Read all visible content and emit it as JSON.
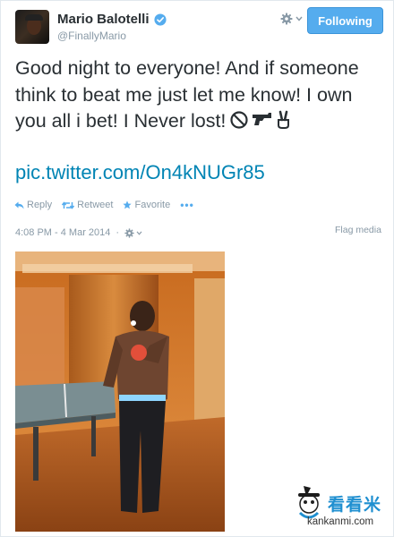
{
  "user": {
    "display_name": "Mario Balotelli",
    "handle": "@FinallyMario",
    "verified": true
  },
  "header": {
    "follow_label": "Following",
    "settings_icon": "gear-icon",
    "accent": "#55acee"
  },
  "tweet": {
    "text": "Good night to everyone! And if someone think to beat me just let me know! I own you all i bet! I Never lost!",
    "emoji_icons": [
      "prohibited-icon",
      "gun-icon",
      "victory-hand-icon"
    ],
    "link": "pic.twitter.com/On4kNUGr85",
    "link_color": "#0084b4"
  },
  "actions": {
    "reply": "Reply",
    "retweet": "Retweet",
    "favorite": "Favorite",
    "more": "•••"
  },
  "meta": {
    "timestamp": "4:08 PM - 4 Mar 2014",
    "separator": "·",
    "flag_media": "Flag media"
  },
  "watermark": {
    "brand": "看看米",
    "url": "kankanmi.com"
  }
}
